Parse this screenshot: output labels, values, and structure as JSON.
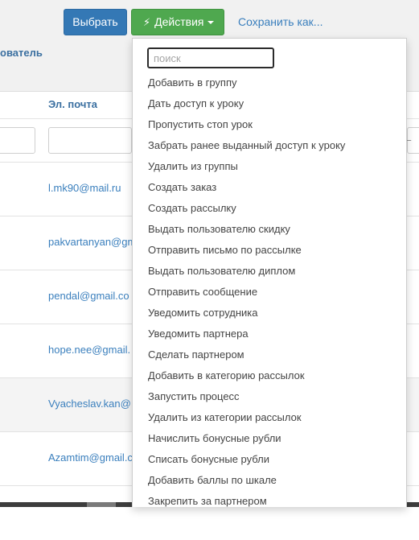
{
  "toolbar": {
    "choose_label": "Выбрать",
    "actions_label": "Действия",
    "save_as_label": "Сохранить как..."
  },
  "table": {
    "user_column_fragment": "ователь",
    "email_column": "Эл. почта",
    "rows": [
      {
        "email": "l.mk90@mail.ru"
      },
      {
        "email": "pakvartanyan@gm"
      },
      {
        "email": "pendal@gmail.co"
      },
      {
        "email": "hope.nee@gmail."
      },
      {
        "email": "Vyacheslav.kan@"
      },
      {
        "email": "Azamtim@gmail.c"
      }
    ],
    "filter_right_mark": "–"
  },
  "dropdown": {
    "search_placeholder": "поиск",
    "items": [
      "Добавить в группу",
      "Дать доступ к уроку",
      "Пропустить стоп урок",
      "Забрать ранее выданный доступ к уроку",
      "Удалить из группы",
      "Создать заказ",
      "Создать рассылку",
      "Выдать пользователю скидку",
      "Отправить письмо по рассылке",
      "Выдать пользователю диплом",
      "Отправить сообщение",
      "Уведомить сотрудника",
      "Уведомить партнера",
      "Сделать партнером",
      "Добавить в категорию рассылок",
      "Запустить процесс",
      "Удалить из категории рассылок",
      "Начислить бонусные рубли",
      "Списать бонусные рубли",
      "Добавить баллы по шкале",
      "Закрепить за партнером"
    ]
  },
  "colors": {
    "primary": "#3478b5",
    "success": "#4fa84f",
    "link": "#3a7fbd"
  }
}
